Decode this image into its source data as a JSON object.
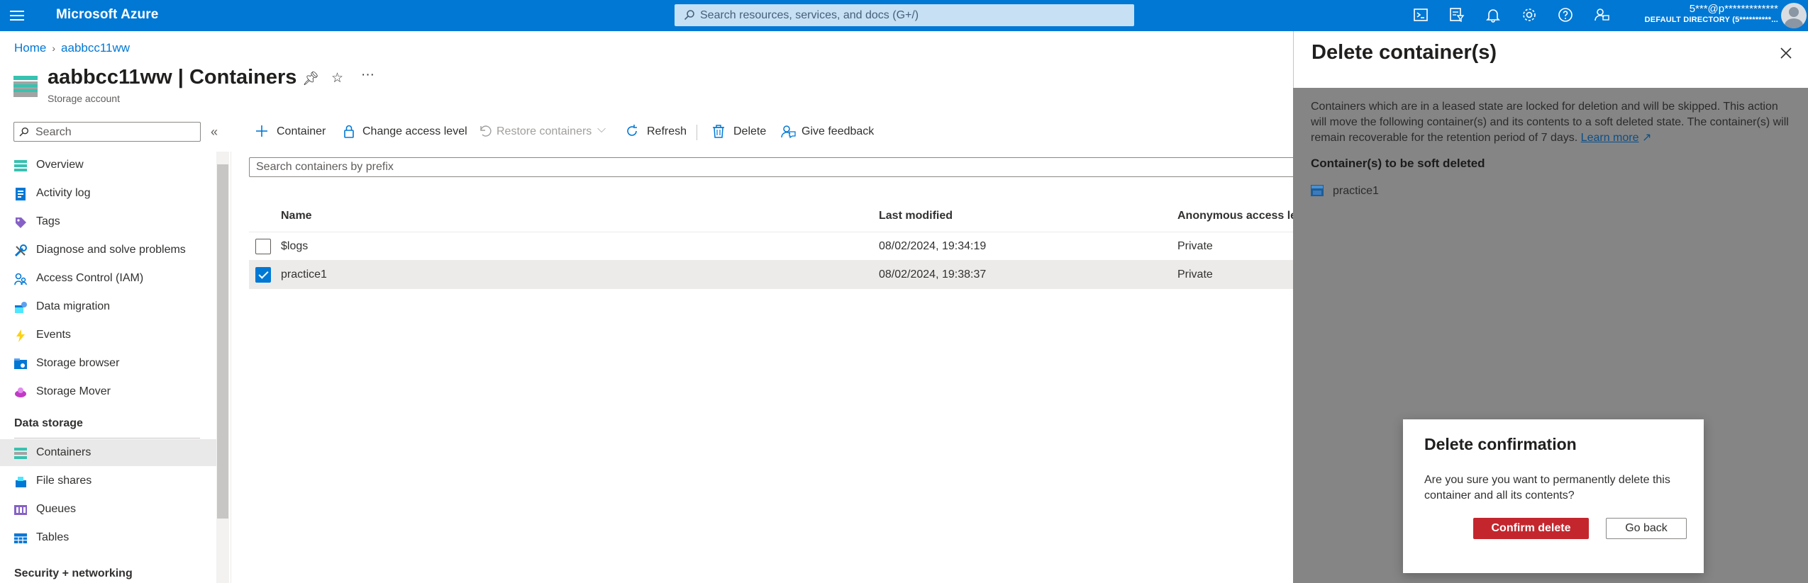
{
  "topbar": {
    "brand": "Microsoft Azure",
    "search_placeholder": "Search resources, services, and docs (G+/)",
    "icons": [
      "cloud-shell-icon",
      "directory-filter-icon",
      "notifications-icon",
      "settings-icon",
      "help-icon",
      "feedback-icon"
    ],
    "account_name": "5***@p*************",
    "account_directory": "DEFAULT DIRECTORY (5**********..."
  },
  "breadcrumb": {
    "home": "Home",
    "resource": "aabbcc11ww"
  },
  "resource": {
    "title": "aabbcc11ww | Containers",
    "subtitle": "Storage account",
    "more": "···"
  },
  "nav": {
    "search_placeholder": "Search",
    "collapse": "«",
    "items": [
      {
        "label": "Overview",
        "icon": "overview-icon"
      },
      {
        "label": "Activity log",
        "icon": "activity-log-icon"
      },
      {
        "label": "Tags",
        "icon": "tags-icon"
      },
      {
        "label": "Diagnose and solve problems",
        "icon": "diagnose-icon"
      },
      {
        "label": "Access Control (IAM)",
        "icon": "iam-icon"
      },
      {
        "label": "Data migration",
        "icon": "data-migration-icon"
      },
      {
        "label": "Events",
        "icon": "events-icon"
      },
      {
        "label": "Storage browser",
        "icon": "storage-browser-icon"
      },
      {
        "label": "Storage Mover",
        "icon": "storage-mover-icon"
      }
    ],
    "group_data_storage": "Data storage",
    "data_storage_items": [
      {
        "label": "Containers",
        "icon": "containers-icon",
        "active": true
      },
      {
        "label": "File shares",
        "icon": "file-shares-icon"
      },
      {
        "label": "Queues",
        "icon": "queues-icon"
      },
      {
        "label": "Tables",
        "icon": "tables-icon"
      }
    ],
    "group_security": "Security + networking"
  },
  "toolbar": {
    "container": "Container",
    "change_access": "Change access level",
    "restore": "Restore containers",
    "refresh": "Refresh",
    "delete": "Delete",
    "feedback": "Give feedback"
  },
  "list": {
    "search_placeholder": "Search containers by prefix",
    "columns": [
      "Name",
      "Last modified",
      "Anonymous access level"
    ],
    "rows": [
      {
        "name": "$logs",
        "modified": "08/02/2024, 19:34:19",
        "access": "Private",
        "checked": false
      },
      {
        "name": "practice1",
        "modified": "08/02/2024, 19:38:37",
        "access": "Private",
        "checked": true
      }
    ]
  },
  "panel": {
    "title": "Delete container(s)",
    "desc_text": "Containers which are in a leased state are locked for deletion and will be skipped. This action will move the following container(s) and its contents to a soft deleted state. The container(s) will remain recoverable for the retention period of 7 days.",
    "learn_more": "Learn more",
    "subheading": "Container(s) to be soft deleted",
    "item": "practice1"
  },
  "dialog": {
    "title": "Delete confirmation",
    "text": "Are you sure you want to permanently delete this container and all its contents?",
    "confirm": "Confirm delete",
    "cancel": "Go back"
  },
  "colors": {
    "azure_blue": "#0078d4",
    "danger": "#c4262e",
    "overlay": "#858585"
  }
}
